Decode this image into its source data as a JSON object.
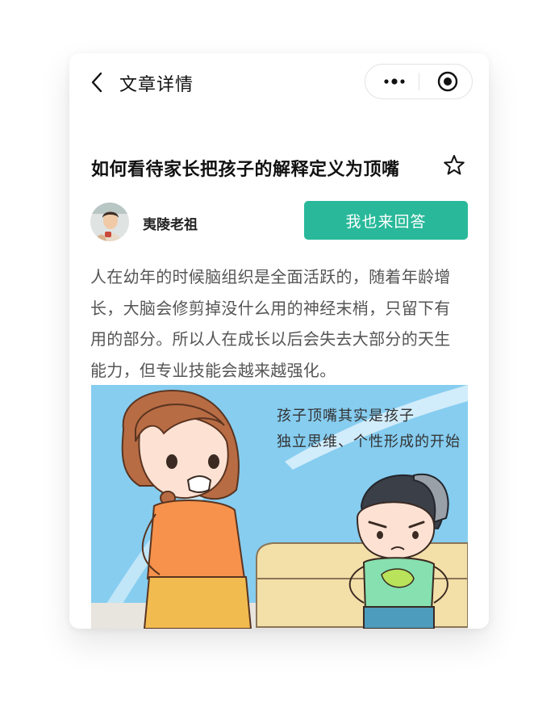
{
  "nav": {
    "title": "文章详情",
    "back_icon": "chevron-left-icon",
    "more_icon": "more-dots-icon",
    "close_icon": "target-close-icon"
  },
  "article": {
    "title": "如何看待家长把孩子的解释定义为顶嘴",
    "favorite_icon": "star-outline-icon",
    "author": {
      "name": "夷陵老祖",
      "avatar_icon": "user-avatar"
    },
    "answer_button_label": "我也来回答",
    "answer_button_color": "#29b99a",
    "body_lines": [
      "人在幼年的时候脑组织是全面活跃的，随着年龄增",
      "长，大脑会修剪掉没什么用的神经末梢，只留下有",
      "用的部分。所以人在成长以后会失去大部分的天生",
      "能力，但专业技能会越来越强化。"
    ],
    "illustration": {
      "caption_lines": [
        "孩子顶嘴其实是孩子",
        "独立思维、个性形成的开始"
      ]
    }
  }
}
